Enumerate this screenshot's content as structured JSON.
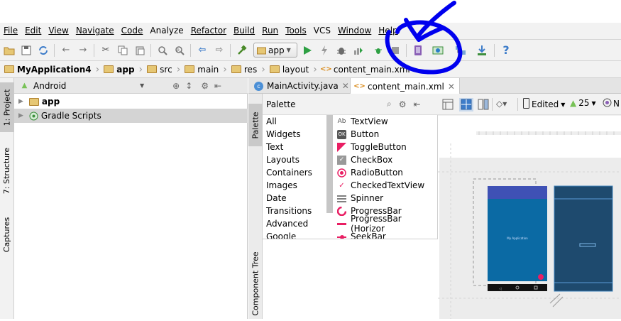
{
  "menu": {
    "items": [
      "File",
      "Edit",
      "View",
      "Navigate",
      "Code",
      "Analyze",
      "Refactor",
      "Build",
      "Run",
      "Tools",
      "VCS",
      "Window",
      "Help"
    ]
  },
  "toolbar": {
    "run_config": "app",
    "icons": [
      "open-folder-icon",
      "save-icon",
      "sync-icon",
      "undo-icon",
      "redo-icon",
      "cut-icon",
      "copy-icon",
      "paste-icon",
      "find-icon",
      "replace-icon",
      "back-icon",
      "forward-icon",
      "make-project-icon",
      "run-icon",
      "apply-changes-icon",
      "debug-icon",
      "profile-icon",
      "attach-debugger-icon",
      "stop-icon",
      "avd-manager-icon",
      "android-monitor-icon",
      "project-structure-icon",
      "sdk-manager-icon",
      "help-icon"
    ]
  },
  "breadcrumb": {
    "items": [
      "MyApplication4",
      "app",
      "src",
      "main",
      "res",
      "layout",
      "content_main.xml"
    ]
  },
  "left_tabs": {
    "project": "1: Project",
    "structure": "7: Structure",
    "captures": "Captures"
  },
  "project_panel": {
    "view_mode": "Android",
    "tree": [
      "app",
      "Gradle Scripts"
    ]
  },
  "editor_tabs": [
    "MainActivity.java",
    "content_main.xml"
  ],
  "palette": {
    "title": "Palette",
    "strip_label": "Palette",
    "categories": [
      "All",
      "Widgets",
      "Text",
      "Layouts",
      "Containers",
      "Images",
      "Date",
      "Transitions",
      "Advanced",
      "Google"
    ],
    "items": [
      "TextView",
      "Button",
      "ToggleButton",
      "CheckBox",
      "RadioButton",
      "CheckedTextView",
      "Spinner",
      "ProgressBar",
      "ProgressBar (Horizor",
      "SeekBar"
    ],
    "component_tree_label": "Component Tree"
  },
  "design_toolbar": {
    "device_state": "Edited",
    "api_level": "25",
    "theme_prefix": "N"
  },
  "preview": {
    "app_title": "My Application",
    "colors": {
      "toolbar": "#3f51b5",
      "content": "#0b6aa4",
      "blueprint": "#1e4a6e",
      "fab": "#e91e63"
    }
  },
  "annotation": {
    "color": "#0000ee"
  }
}
